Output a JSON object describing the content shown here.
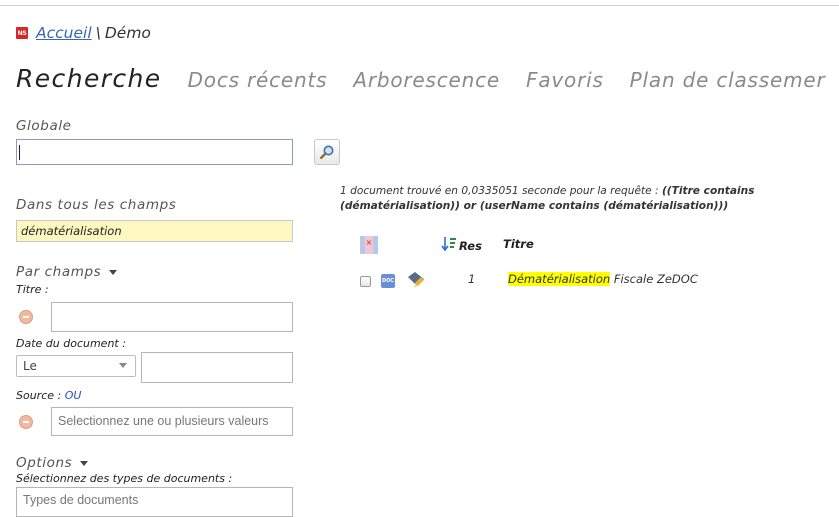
{
  "breadcrumb": {
    "logo": "NS",
    "home": "Accueil",
    "separator": "\\",
    "current": "Démo"
  },
  "tabs": [
    {
      "label": "Recherche",
      "active": true
    },
    {
      "label": "Docs récents",
      "active": false
    },
    {
      "label": "Arborescence",
      "active": false
    },
    {
      "label": "Favoris",
      "active": false
    },
    {
      "label": "Plan de classemer",
      "active": false
    }
  ],
  "global": {
    "label": "Globale",
    "value": ""
  },
  "all_fields": {
    "label": "Dans tous les champs",
    "value": "dématérialisation"
  },
  "par_champs": {
    "label": "Par champs",
    "titre_label": "Titre :",
    "titre_value": "",
    "date_label": "Date du document :",
    "date_operator": "Le",
    "date_value": "",
    "source_label": "Source :",
    "source_op": "OU",
    "source_placeholder": "Selectionnez une ou plusieurs valeurs"
  },
  "options": {
    "label": "Options",
    "types_label": "Sélectionnez des types de documents :",
    "types_placeholder": "Types de documents"
  },
  "results": {
    "summary_prefix": "1 document trouvé en 0,0335051 seconde pour la requête : ",
    "summary_query_line1": "((Titre contains",
    "summary_query_line2": "(dématérialisation)) or (userName contains (dématérialisation)))",
    "col_res": "Res",
    "col_title": "Titre",
    "rows": [
      {
        "num": "1",
        "title_highlight": "Dématérialisation",
        "title_rest": " Fiscale ZeDOC",
        "doc_icon": "DOC"
      }
    ]
  },
  "colors": {
    "accent_link": "#3a66b0",
    "highlight": "#ffff00",
    "yellow_field": "#fcf8c0",
    "logo_red": "#d9262c"
  }
}
